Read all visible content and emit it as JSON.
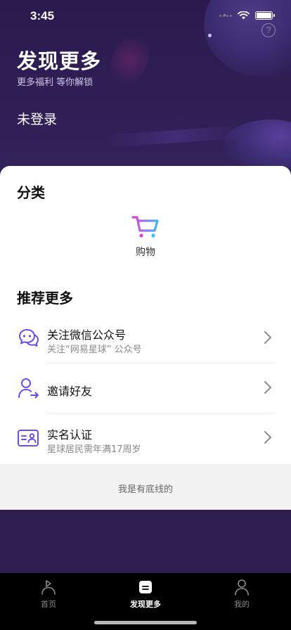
{
  "status_bar": {
    "time": "3:45"
  },
  "header": {
    "title": "发现更多",
    "subtitle": "更多福利 等你解锁",
    "login_state": "未登录",
    "help_icon": "question-circle-icon"
  },
  "categories": {
    "title": "分类",
    "items": [
      {
        "label": "购物",
        "icon": "shopping-cart-icon"
      }
    ]
  },
  "recommend": {
    "title": "推荐更多",
    "items": [
      {
        "title": "关注微信公众号",
        "subtitle": "关注“网易星球” 公众号",
        "icon": "wechat-chat-icon"
      },
      {
        "title": "邀请好友",
        "subtitle": "",
        "icon": "invite-user-icon"
      },
      {
        "title": "实名认证",
        "subtitle": "星球居民需年满17周岁",
        "icon": "id-card-icon"
      }
    ]
  },
  "footer": {
    "end_text": "我是有底线的"
  },
  "tab_bar": {
    "tabs": [
      {
        "label": "首页",
        "icon": "home-flag-icon",
        "active": false
      },
      {
        "label": "发现更多",
        "icon": "discover-icon",
        "active": true
      },
      {
        "label": "我的",
        "icon": "profile-icon",
        "active": false
      }
    ]
  },
  "colors": {
    "header_bg": "#2d1e4f",
    "accent_purple": "#6b4ee6",
    "cart_gradient_start": "#e23cd8",
    "cart_gradient_end": "#3fb6f5",
    "tab_bar_bg": "#000000"
  }
}
